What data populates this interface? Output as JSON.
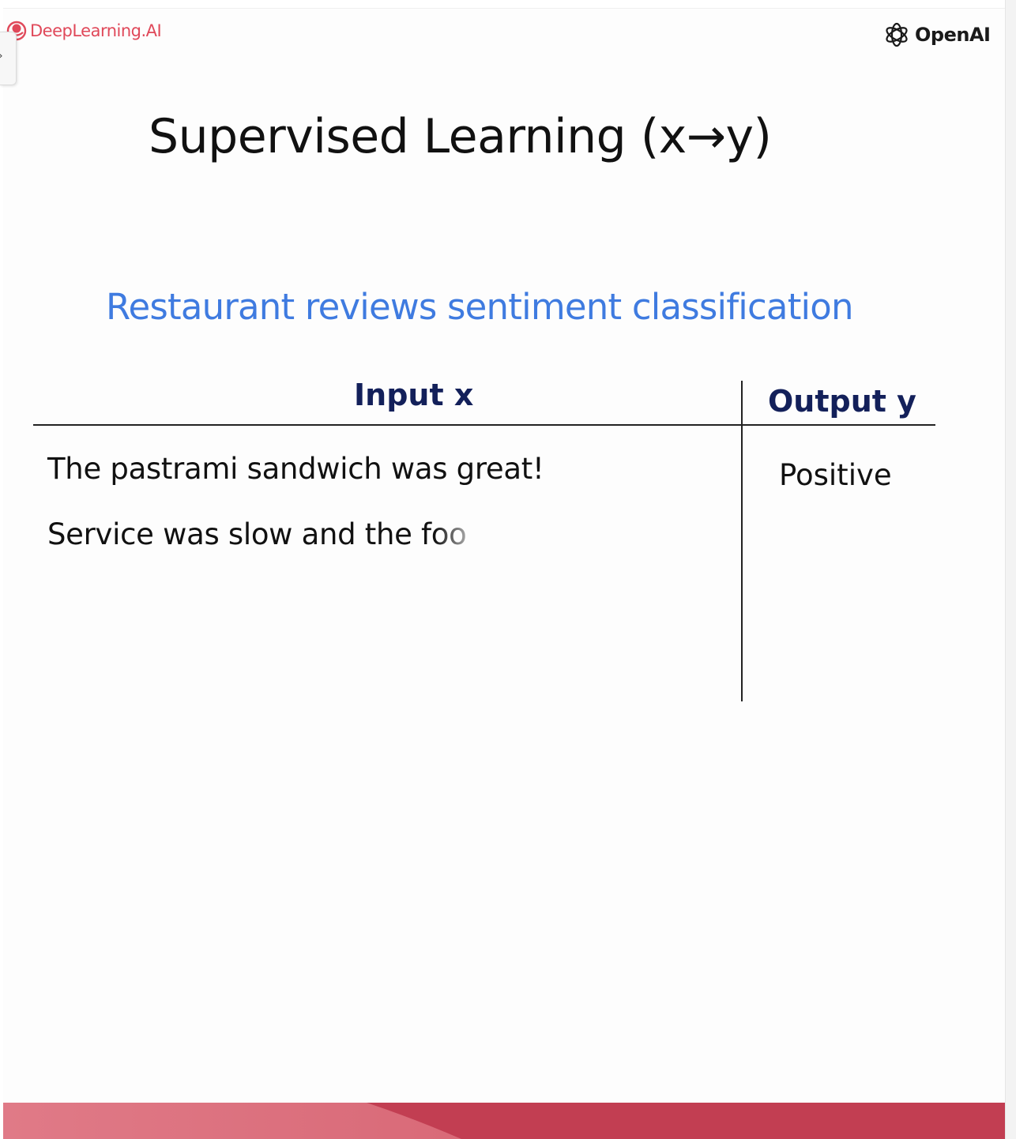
{
  "branding": {
    "left_logo_text": "DeepLearning.AI",
    "right_logo_text": "OpenAI"
  },
  "slide": {
    "title": "Supervised Learning (x→y)",
    "subtitle": "Restaurant reviews sentiment classification",
    "table": {
      "headers": {
        "input": "Input x",
        "output": "Output y"
      },
      "rows": [
        {
          "input": "The pastrami sandwich was great!",
          "output": "Positive"
        },
        {
          "input": "Service was slow and the foo",
          "output": ""
        }
      ]
    }
  },
  "colors": {
    "brand_red": "#e0495a",
    "accent_blue": "#3f7be0",
    "header_navy": "#13205a",
    "band_dark": "#c23e52",
    "band_light": "#e07a87"
  },
  "icons": {
    "side_tab": "chevron-right-icon",
    "left_logo": "deeplearning-logo-icon",
    "right_logo": "openai-logo-icon"
  }
}
